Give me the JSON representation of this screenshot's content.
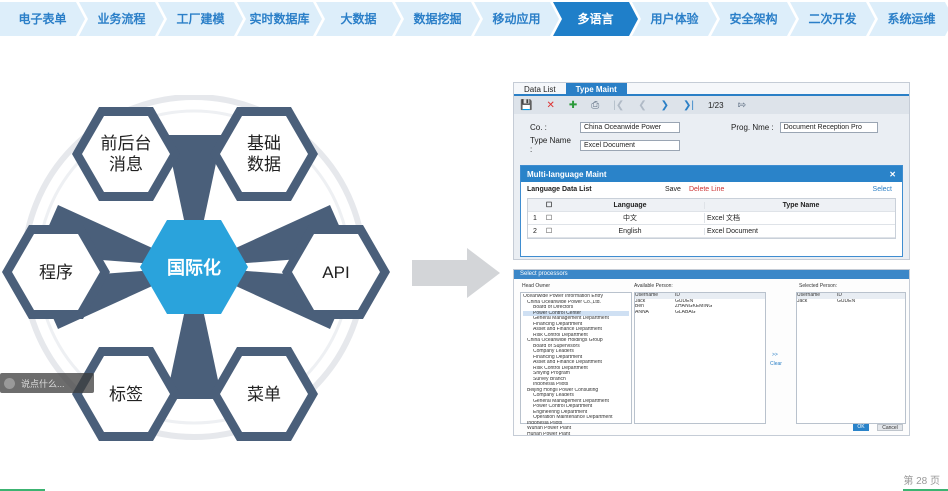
{
  "nav": {
    "items": [
      {
        "label": "电子表单"
      },
      {
        "label": "业务流程"
      },
      {
        "label": "工厂建模"
      },
      {
        "label": "实时数据库"
      },
      {
        "label": "大数据"
      },
      {
        "label": "数据挖掘"
      },
      {
        "label": "移动应用"
      },
      {
        "label": "多语言"
      },
      {
        "label": "用户体验"
      },
      {
        "label": "安全架构"
      },
      {
        "label": "二次开发"
      },
      {
        "label": "系统运维"
      }
    ],
    "active_index": 7
  },
  "diagram": {
    "center": "国际化",
    "top_left": "前后台\n消息",
    "top_right": "基础\n数据",
    "left": "程序",
    "right": "API",
    "bottom_left": "标签",
    "bottom_right": "菜单"
  },
  "window1": {
    "tabs": [
      "Data List",
      "Type Maint"
    ],
    "pager": "1/23",
    "co_label": "Co. :",
    "co_value": "China Oceanwide Power",
    "prog_label": "Prog. Nme :",
    "prog_value": "Document Reception Pro",
    "type_label": "Type Name :",
    "type_value": "Excel Document",
    "dialog_title": "Multi-language Maint",
    "list_title": "Language Data List",
    "save": "Save",
    "delete": "Delete Line",
    "select": "Select",
    "col_language": "Language",
    "col_type": "Type Name",
    "rows": [
      {
        "no": "1",
        "language": "中文",
        "type": "Excel 文档"
      },
      {
        "no": "2",
        "language": "English",
        "type": "Excel Document"
      }
    ]
  },
  "window2": {
    "title": "Select processors",
    "dept_label": "Head Owner",
    "available_label": "Available Person:",
    "selected_label": "Selected Person:",
    "avail_headers": [
      "Username",
      "ID"
    ],
    "avail_rows": [
      [
        "Jack",
        "GUDEN"
      ],
      [
        "Ben",
        "ZHANGKEMING"
      ],
      [
        "ANNA",
        "GLABAG"
      ]
    ],
    "sel_headers": [
      "Username",
      "ID"
    ],
    "sel_rows": [
      [
        "Jack",
        "GUDEN"
      ]
    ],
    "clear": "Clear",
    "ok": "OK",
    "cancel": "Cancel",
    "tree": [
      "Oceanwide Power Information Entry",
      "China Oceanwide Power Co.,Ltd.",
      "Board of Directors",
      "Power Control Center",
      "General Management Department",
      "Financing Department",
      "Asset and Finance Department",
      "Risk Control Department",
      "China Oceanwide Holdings Group",
      "Board of Supervisors",
      "Company Leaders",
      "Financing Department",
      "Asset and Finance Department",
      "Risk Control Department",
      "Shiying Program",
      "Survey Branch",
      "Indonesia Pilots",
      "Beijing Hongli Power Consulting",
      "Company Leaders",
      "General Management Department",
      "Power Control Department",
      "Engineering Department",
      "Operation Maintenance Department",
      "Indonesia Pilots",
      "Wuhan Power Plant",
      "Hunan Power Plant"
    ]
  },
  "comment": {
    "placeholder": "说点什么..."
  },
  "page": {
    "label": "第 28 页"
  }
}
